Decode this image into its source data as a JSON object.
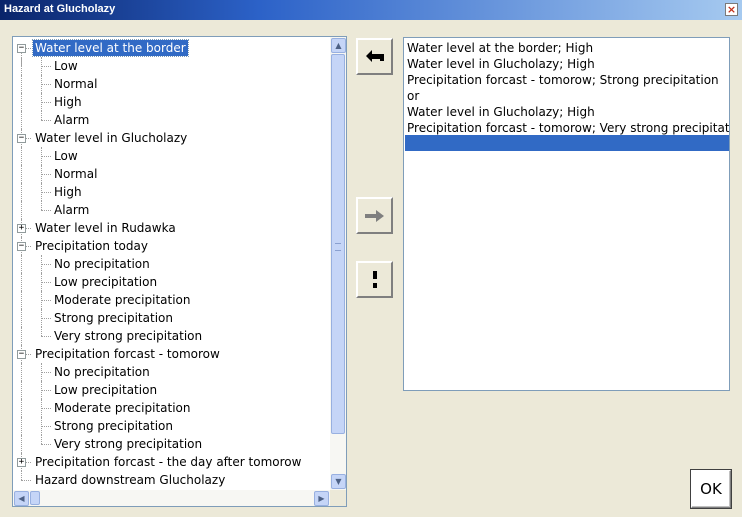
{
  "window": {
    "title": "Hazard at Glucholazy",
    "close_label": "×"
  },
  "tree": {
    "nodes": [
      {
        "label": "Water level at the border",
        "level": 0,
        "expander": "−",
        "selected": true
      },
      {
        "label": "Low",
        "level": 1
      },
      {
        "label": "Normal",
        "level": 1
      },
      {
        "label": "High",
        "level": 1
      },
      {
        "label": "Alarm",
        "level": 1
      },
      {
        "label": "Water level in Glucholazy",
        "level": 0,
        "expander": "−"
      },
      {
        "label": "Low",
        "level": 1
      },
      {
        "label": "Normal",
        "level": 1
      },
      {
        "label": "High",
        "level": 1
      },
      {
        "label": "Alarm",
        "level": 1
      },
      {
        "label": "Water level in Rudawka",
        "level": 0,
        "expander": "+"
      },
      {
        "label": "Precipitation today",
        "level": 0,
        "expander": "−"
      },
      {
        "label": "No precipitation",
        "level": 1
      },
      {
        "label": "Low precipitation",
        "level": 1
      },
      {
        "label": "Moderate precipitation",
        "level": 1
      },
      {
        "label": "Strong precipitation",
        "level": 1
      },
      {
        "label": "Very strong precipitation",
        "level": 1
      },
      {
        "label": "Precipitation forcast - tomorow",
        "level": 0,
        "expander": "−"
      },
      {
        "label": "No precipitation",
        "level": 1
      },
      {
        "label": "Low precipitation",
        "level": 1
      },
      {
        "label": "Moderate precipitation",
        "level": 1
      },
      {
        "label": "Strong precipitation",
        "level": 1
      },
      {
        "label": "Very strong precipitation",
        "level": 1
      },
      {
        "label": "Precipitation forcast - the day after tomorow",
        "level": 0,
        "expander": "+"
      },
      {
        "label": "Hazard downstream Glucholazy",
        "level": 0
      }
    ]
  },
  "rules": {
    "lines": [
      "Water level at the border; High",
      "Water level in Glucholazy; High",
      "Precipitation forcast - tomorow; Strong precipitation",
      "or",
      "Water level in Glucholazy; High",
      "Precipitation forcast - tomorow; Very strong precipitation"
    ]
  },
  "buttons": {
    "ok_label": "OK"
  },
  "icons": {
    "insert": "return-arrow-icon",
    "add": "right-arrow-icon",
    "or": "exclamation-icon"
  },
  "colors": {
    "selection": "#316ac5",
    "title_bar": "#0a246a"
  }
}
